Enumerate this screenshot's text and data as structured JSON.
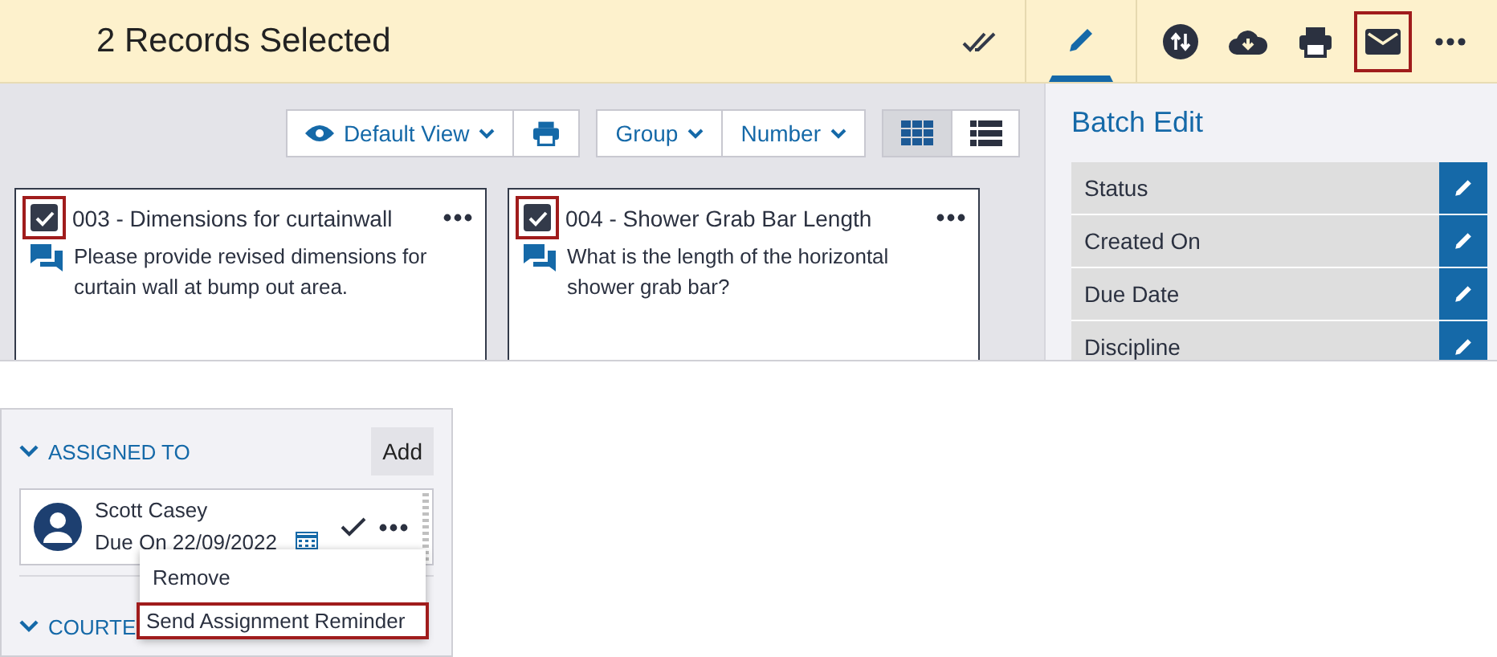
{
  "header": {
    "title": "2 Records Selected",
    "tools": [
      {
        "kind": "select-all",
        "selected": false,
        "highlighted": false
      },
      {
        "kind": "edit",
        "selected": true,
        "highlighted": false
      },
      {
        "kind": "sync",
        "selected": false,
        "highlighted": false
      },
      {
        "kind": "download",
        "selected": false,
        "highlighted": false
      },
      {
        "kind": "print",
        "selected": false,
        "highlighted": false
      },
      {
        "kind": "email",
        "selected": false,
        "highlighted": true
      },
      {
        "kind": "more",
        "selected": false,
        "highlighted": false
      }
    ]
  },
  "toolbar": {
    "view_button": "Default View",
    "group_button": "Group",
    "sort_button": "Number",
    "layouts": [
      {
        "kind": "grid",
        "selected": true
      },
      {
        "kind": "list",
        "selected": false
      }
    ]
  },
  "cards": [
    {
      "title": "003 - Dimensions for curtainwall",
      "body": "Please provide revised dimensions for curtain wall at bump out area.",
      "checked": true,
      "highlighted": true
    },
    {
      "title": "004 - Shower Grab Bar Length",
      "body": "What is the length of the horizontal shower grab bar?",
      "checked": true,
      "highlighted": true
    }
  ],
  "batch_edit": {
    "title": "Batch Edit",
    "fields": [
      "Status",
      "Created On",
      "Due Date",
      "Discipline"
    ]
  },
  "assignments": {
    "sections": [
      {
        "title": "ASSIGNED TO",
        "expanded": true,
        "add_button": "Add"
      },
      {
        "title": "COURTE",
        "expanded": true
      }
    ],
    "assignee": {
      "name": "Scott Casey",
      "due": "Due On 22/09/2022"
    },
    "menu": [
      {
        "label": "Remove",
        "highlighted": false
      },
      {
        "label": "Send Assignment Reminder",
        "highlighted": true
      }
    ]
  }
}
